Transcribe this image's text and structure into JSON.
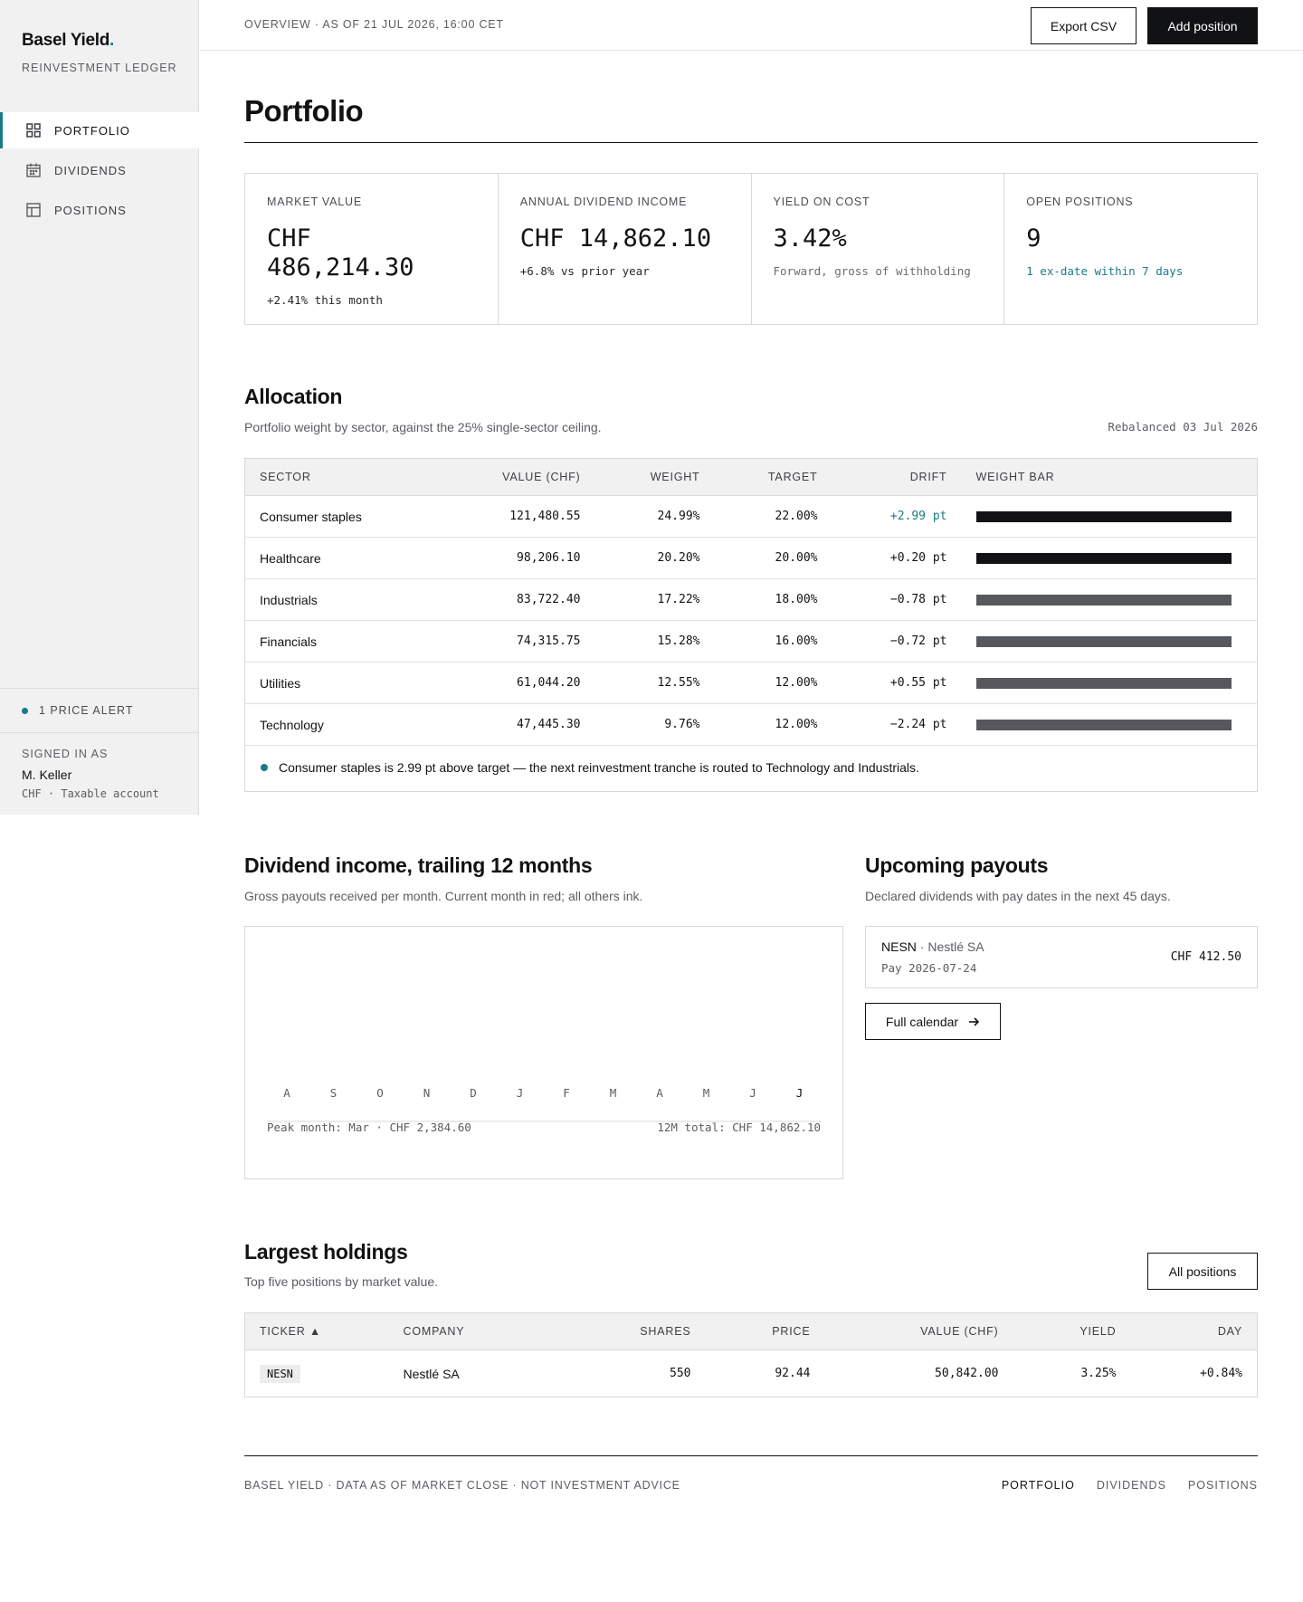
{
  "sidebar": {
    "brand": "Basel Yield",
    "brand_dot": ".",
    "subtitle": "REINVESTMENT LEDGER",
    "nav": [
      {
        "label": "PORTFOLIO",
        "icon": "grid-icon",
        "active": true
      },
      {
        "label": "DIVIDENDS",
        "icon": "calendar-icon",
        "active": false
      },
      {
        "label": "POSITIONS",
        "icon": "table-icon",
        "active": false
      }
    ],
    "alert": "1 PRICE ALERT",
    "signed_label": "SIGNED IN AS",
    "user": "M. Keller",
    "account": "CHF · Taxable account"
  },
  "topbar": {
    "crumb": "OVERVIEW · AS OF 21 JUL 2026, 16:00 CET",
    "export_label": "Export CSV",
    "add_label": "Add position"
  },
  "page_title": "Portfolio",
  "kpis": [
    {
      "label": "MARKET VALUE",
      "value": "CHF 486,214.30",
      "sub": "+2.41% this month"
    },
    {
      "label": "ANNUAL DIVIDEND INCOME",
      "value": "CHF 14,862.10",
      "sub": "+6.8% vs prior year"
    },
    {
      "label": "YIELD ON COST",
      "value": "3.42%",
      "sub": "Forward, gross of withholding"
    },
    {
      "label": "OPEN POSITIONS",
      "value": "9",
      "sub": "1 ex-date within 7 days"
    }
  ],
  "allocation": {
    "title": "Allocation",
    "desc": "Portfolio weight by sector, against the 25% single-sector ceiling.",
    "rebalanced": "Rebalanced 03 Jul 2026",
    "columns": [
      "SECTOR",
      "VALUE (CHF)",
      "WEIGHT",
      "TARGET",
      "DRIFT",
      "WEIGHT BAR"
    ],
    "rows": [
      {
        "sector": "Consumer staples",
        "value": "121,480.55",
        "weight": "24.99%",
        "target": "22.00%",
        "drift": "+2.99 pt",
        "bar_pct": 100,
        "over": true
      },
      {
        "sector": "Healthcare",
        "value": "98,206.10",
        "weight": "20.20%",
        "target": "20.00%",
        "drift": "+0.20 pt",
        "bar_pct": 100,
        "over": false
      },
      {
        "sector": "Industrials",
        "value": "83,722.40",
        "weight": "17.22%",
        "target": "18.00%",
        "drift": "−0.78 pt",
        "bar_pct": 100,
        "over": false
      },
      {
        "sector": "Financials",
        "value": "74,315.75",
        "weight": "15.28%",
        "target": "16.00%",
        "drift": "−0.72 pt",
        "bar_pct": 100,
        "over": false
      },
      {
        "sector": "Utilities",
        "value": "61,044.20",
        "weight": "12.55%",
        "target": "12.00%",
        "drift": "+0.55 pt",
        "bar_pct": 100,
        "over": false
      },
      {
        "sector": "Technology",
        "value": "47,445.30",
        "weight": "9.76%",
        "target": "12.00%",
        "drift": "−2.24 pt",
        "bar_pct": 100,
        "over": false
      }
    ],
    "colors": {
      "dark": "#111214",
      "gray": "#55585d"
    },
    "note": "Consumer staples is 2.99 pt above target — the next reinvestment tranche is routed to Technology and Industrials."
  },
  "dividend_chart": {
    "title": "Dividend income, trailing 12 months",
    "desc": "Gross payouts received per month. Current month in red; all others ink.",
    "months": [
      "A",
      "S",
      "O",
      "N",
      "D",
      "J",
      "F",
      "M",
      "A",
      "M",
      "J",
      "J"
    ],
    "current_index": 11,
    "peak": "Peak month: Mar · CHF 2,384.60",
    "total": "12M total: CHF 14,862.10"
  },
  "payouts": {
    "title": "Upcoming payouts",
    "desc": "Declared dividends with pay dates in the next 45 days.",
    "items": [
      {
        "ticker": "NESN",
        "company": " · Nestlé SA",
        "date": "Pay 2026-07-24",
        "amount": "CHF 412.50"
      }
    ],
    "calendar_label": "Full calendar"
  },
  "holdings": {
    "title": "Largest holdings",
    "desc": "Top five positions by market value.",
    "all_label": "All positions",
    "columns": [
      "TICKER ▲",
      "COMPANY",
      "SHARES",
      "PRICE",
      "VALUE (CHF)",
      "YIELD",
      "DAY"
    ],
    "rows": [
      {
        "ticker": "NESN",
        "company": "Nestlé SA",
        "shares": "550",
        "price": "92.44",
        "value": "50,842.00",
        "yield": "3.25%",
        "day": "+0.84%"
      }
    ]
  },
  "footer": {
    "left": "BASEL YIELD · DATA AS OF MARKET CLOSE · NOT INVESTMENT ADVICE",
    "links": [
      "PORTFOLIO",
      "DIVIDENDS",
      "POSITIONS"
    ]
  }
}
